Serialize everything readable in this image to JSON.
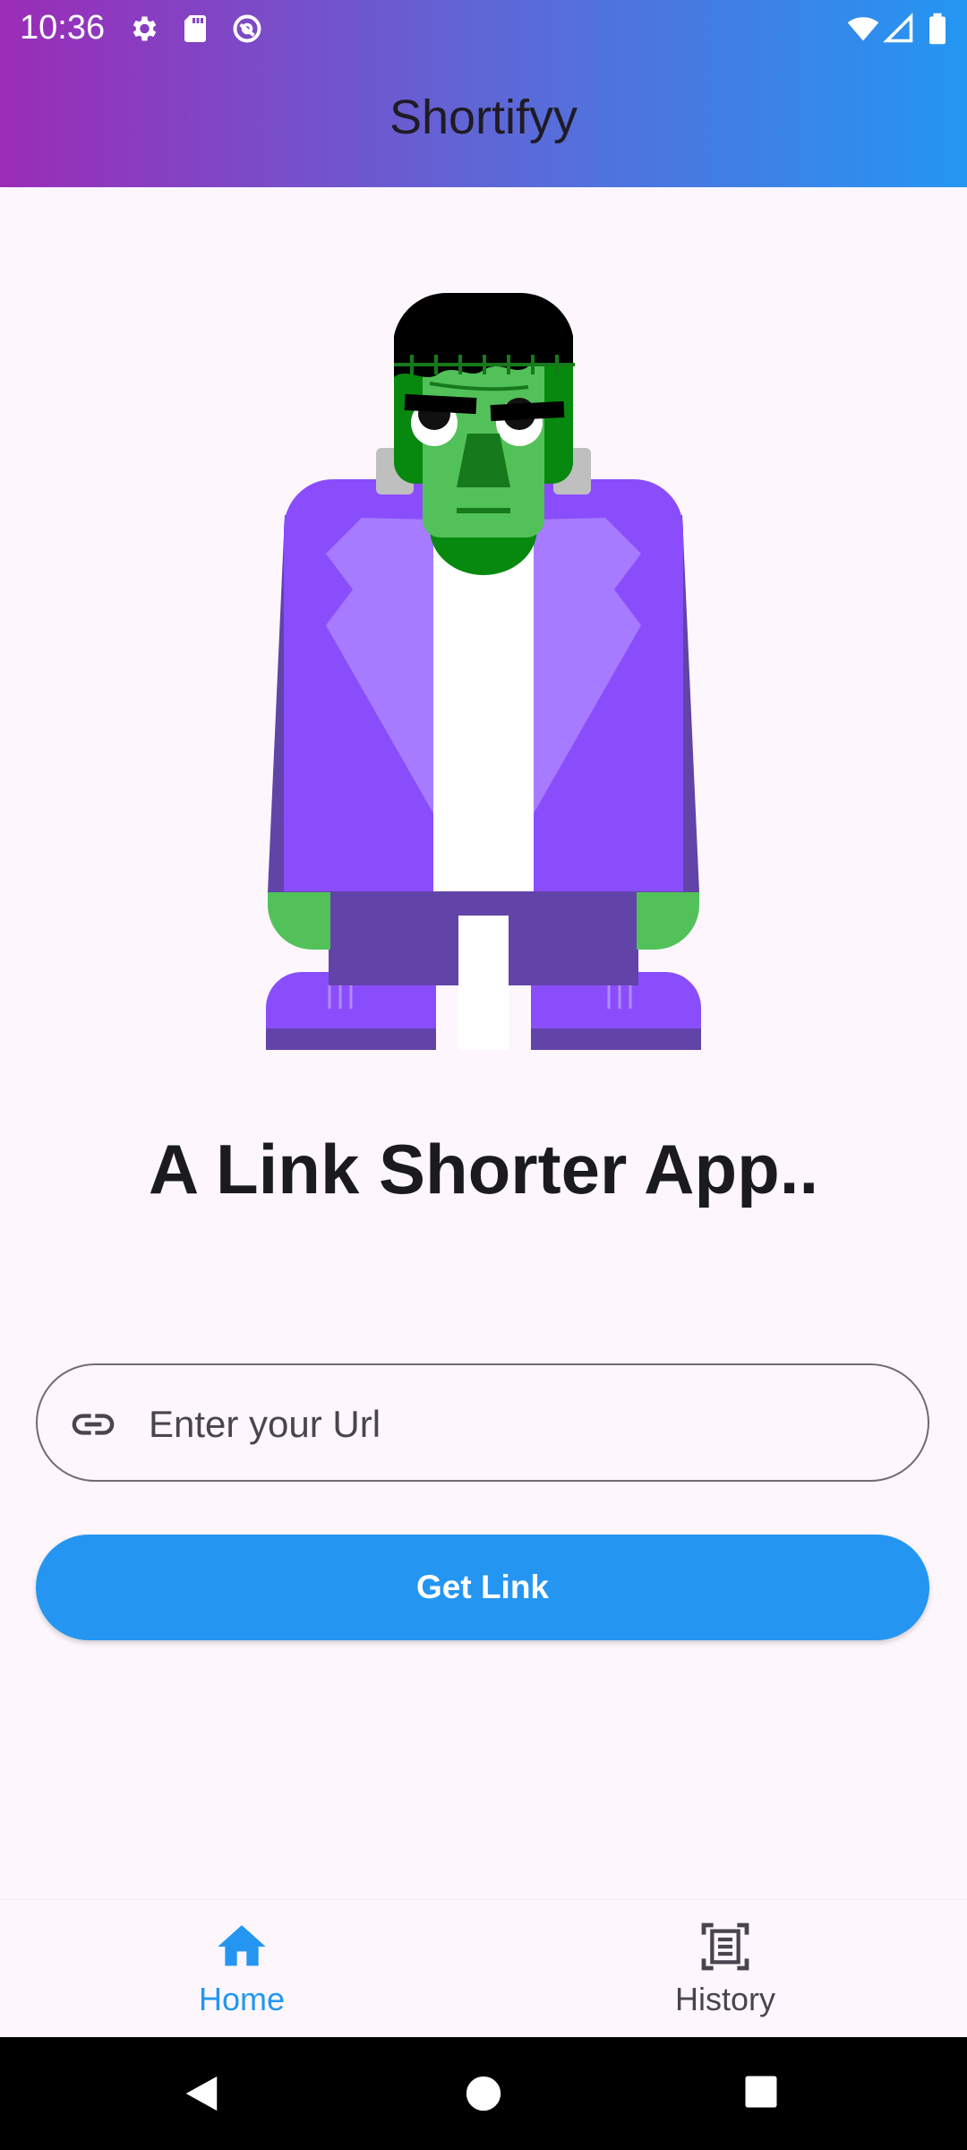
{
  "status_bar": {
    "time": "10:36",
    "left_icons": [
      "settings-icon",
      "sd-card-icon",
      "at-sign-icon"
    ],
    "right_icons": [
      "wifi-icon",
      "signal-icon",
      "battery-icon"
    ]
  },
  "app_bar": {
    "title": "Shortifyy"
  },
  "hero": {
    "illustration": "frankenstein-character-illustration"
  },
  "headline": "A Link Shorter App..",
  "url_input": {
    "placeholder": "Enter your Url",
    "value": "",
    "icon": "link-icon"
  },
  "get_link_button": {
    "label": "Get Link"
  },
  "bottom_nav": {
    "items": [
      {
        "label": "Home",
        "icon": "home-icon",
        "active": true
      },
      {
        "label": "History",
        "icon": "document-scan-icon",
        "active": false
      }
    ]
  },
  "colors": {
    "accent": "#2496f2",
    "gradient_start": "#9b2cb7",
    "gradient_end": "#2496f2",
    "background": "#fdf7fd"
  },
  "system_nav": [
    "back-icon",
    "home-circle-icon",
    "recents-icon"
  ]
}
